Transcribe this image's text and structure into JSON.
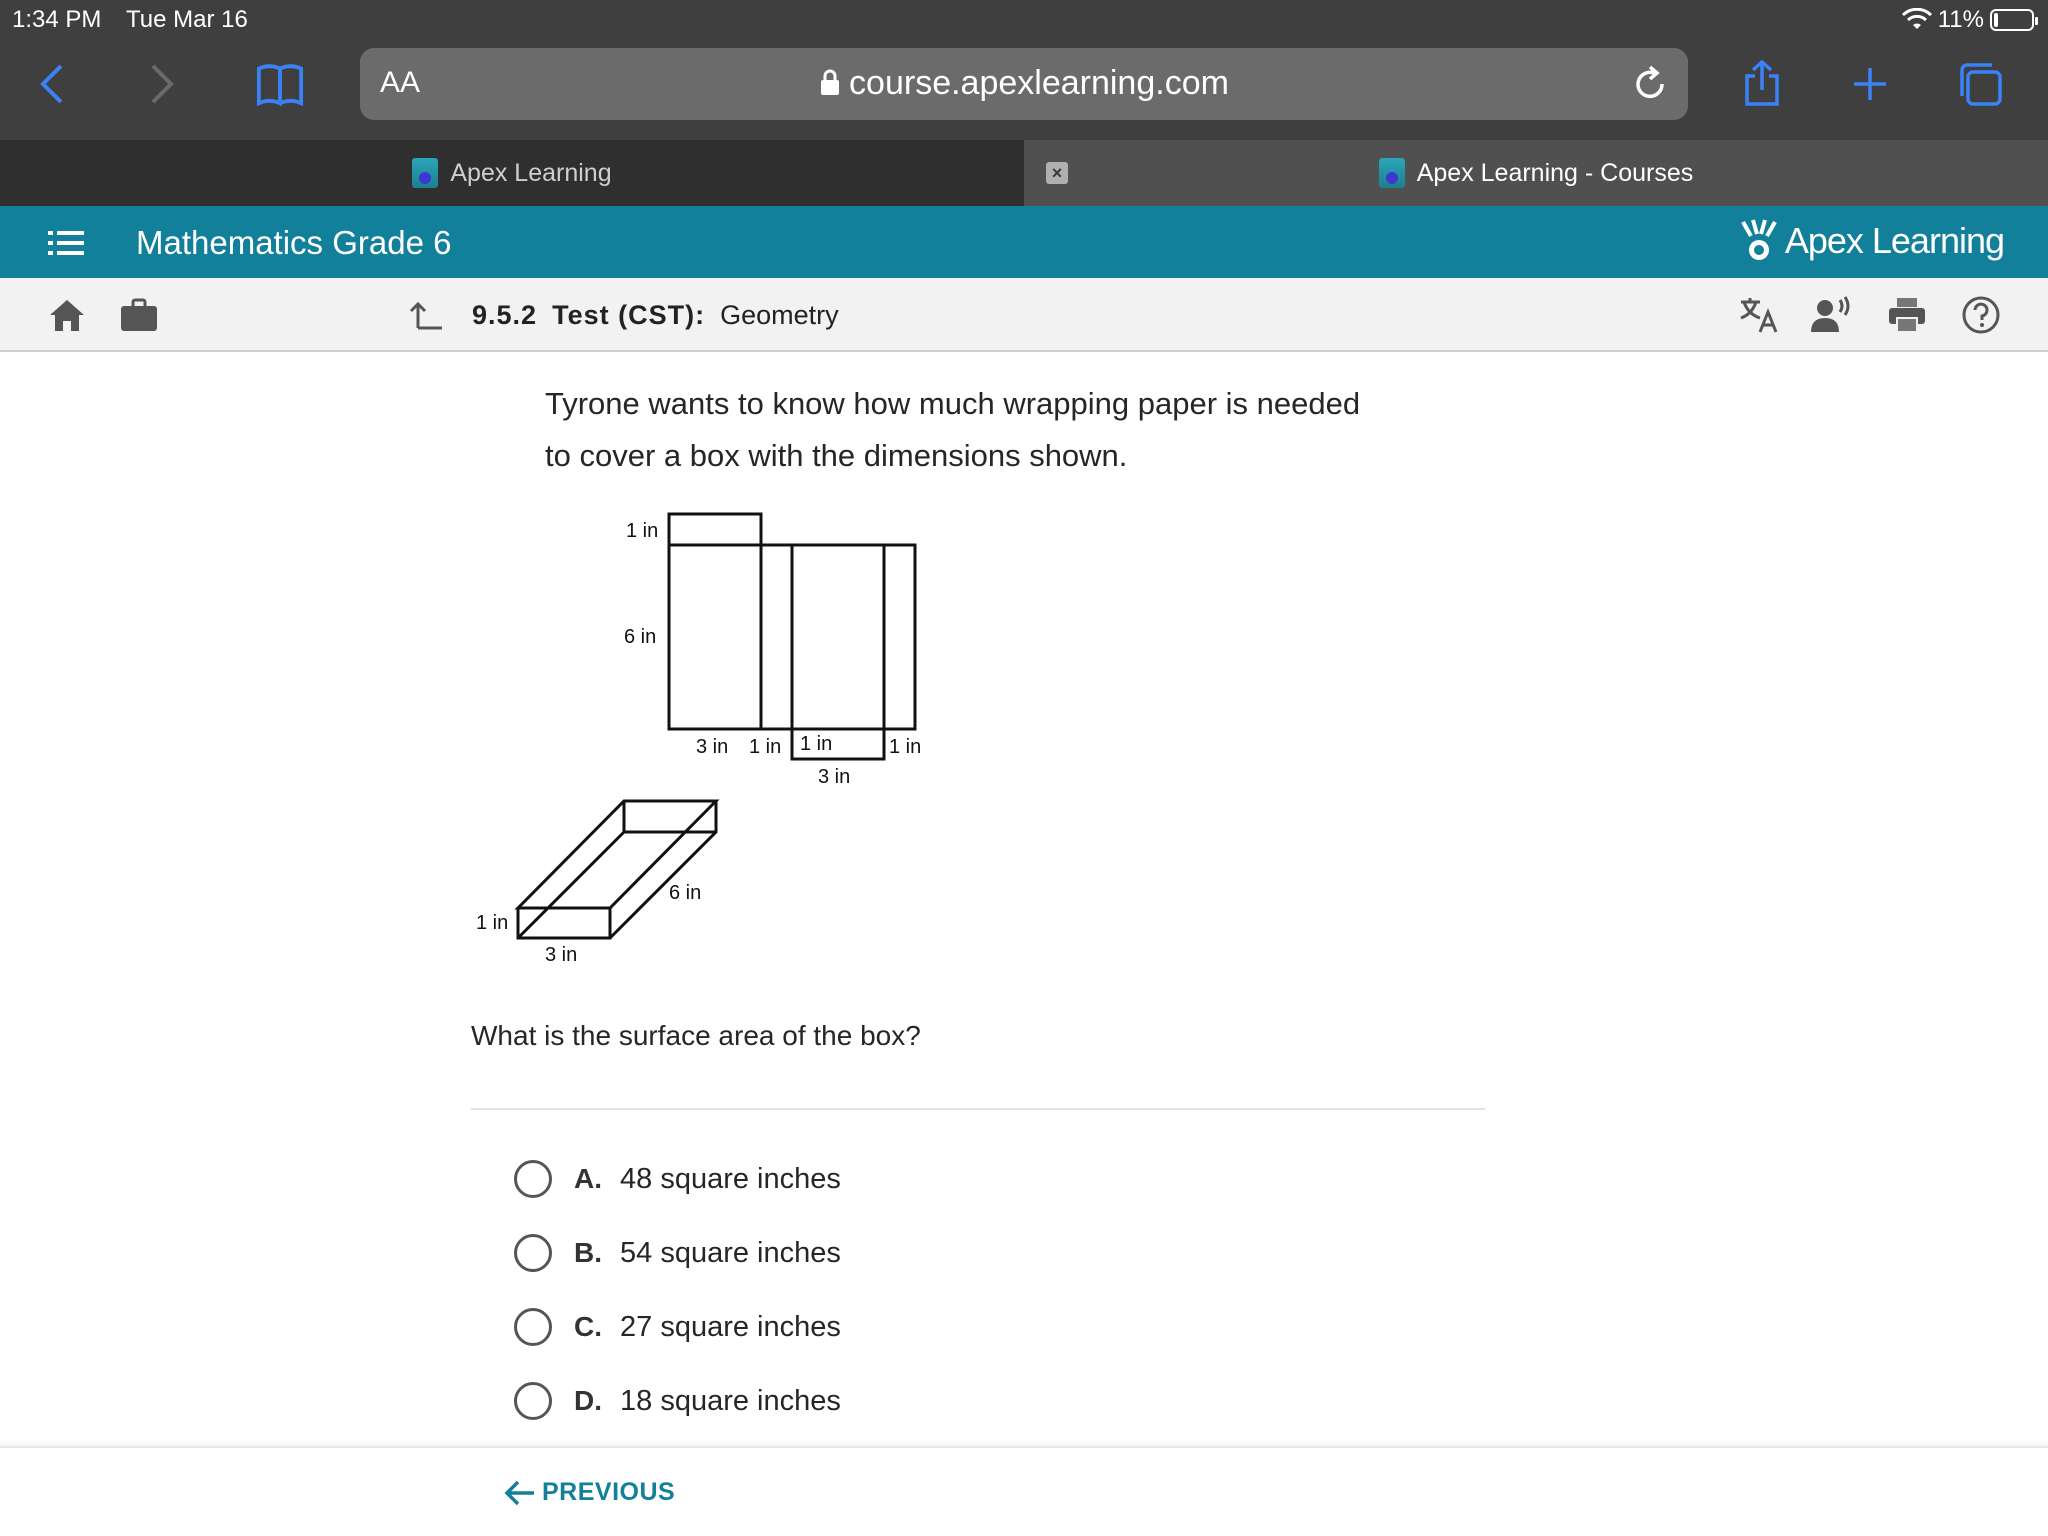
{
  "status": {
    "time": "1:34 PM",
    "date": "Tue Mar 16",
    "battery_text": "11%",
    "battery_level": 0.11
  },
  "browser": {
    "text_size_label": "AA",
    "url": "course.apexlearning.com",
    "tabs": [
      {
        "label": "Apex Learning",
        "active": false
      },
      {
        "label": "Apex Learning - Courses",
        "active": true
      }
    ],
    "tab_close_glyph": "×"
  },
  "header": {
    "course_title": "Mathematics Grade 6",
    "logo_text": "Apex Learning"
  },
  "toolbar": {
    "lesson_number": "9.5.2",
    "lesson_type": "Test (CST):",
    "lesson_name": "Geometry"
  },
  "question": {
    "stem": "Tyrone wants to know how much wrapping paper is needed to cover a box with the dimensions shown.",
    "prompt": "What is the surface area of the box?",
    "diagram_labels": {
      "net_top": "1 in",
      "net_height": "6 in",
      "net_w1": "3 in",
      "net_w2": "1 in",
      "net_w3": "1 in",
      "net_w4": "1 in",
      "net_bottom": "3 in",
      "box_depth": "6 in",
      "box_height": "1 in",
      "box_width": "3 in"
    },
    "options": [
      {
        "letter": "A.",
        "text": "48 square inches"
      },
      {
        "letter": "B.",
        "text": "54 square inches"
      },
      {
        "letter": "C.",
        "text": "27 square inches"
      },
      {
        "letter": "D.",
        "text": "18 square inches"
      }
    ]
  },
  "footer": {
    "previous_label": "PREVIOUS"
  },
  "colors": {
    "brand_teal": "#12809a",
    "chrome_bg": "#3f3f3f",
    "safari_blue": "#3a82f7"
  },
  "icons": [
    "back-icon",
    "forward-icon",
    "bookmarks-icon",
    "lock-icon",
    "reload-icon",
    "share-icon",
    "new-tab-icon",
    "tabs-icon",
    "wifi-icon",
    "battery-icon",
    "menu-icon",
    "home-icon",
    "briefcase-icon",
    "up-arrow-icon",
    "translate-icon",
    "read-aloud-icon",
    "print-icon",
    "help-icon",
    "arrow-left-icon"
  ]
}
